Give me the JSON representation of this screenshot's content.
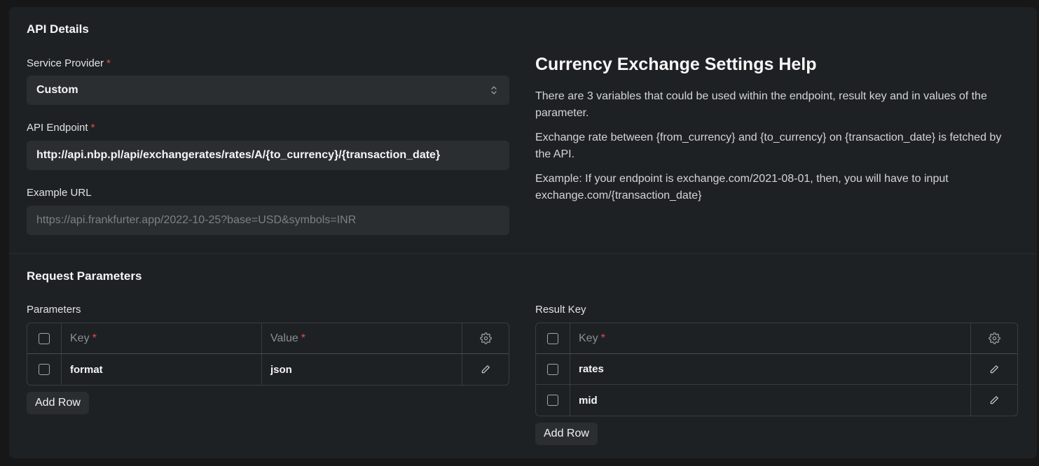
{
  "api_details": {
    "title": "API Details",
    "service_provider": {
      "label": "Service Provider",
      "required_mark": "*",
      "value": "Custom"
    },
    "api_endpoint": {
      "label": "API Endpoint",
      "required_mark": "*",
      "value": "http://api.nbp.pl/api/exchangerates/rates/A/{to_currency}/{transaction_date}"
    },
    "example_url": {
      "label": "Example URL",
      "placeholder": "https://api.frankfurter.app/2022-10-25?base=USD&symbols=INR"
    }
  },
  "help": {
    "title": "Currency Exchange Settings Help",
    "paragraphs": [
      "There are 3 variables that could be used within the endpoint, result key and in values of the parameter.",
      "Exchange rate between {from_currency} and {to_currency} on {transaction_date} is fetched by the API.",
      "Example: If your endpoint is exchange.com/2021-08-01, then, you will have to input exchange.com/{transaction_date}"
    ]
  },
  "request_parameters": {
    "title": "Request Parameters",
    "parameters": {
      "label": "Parameters",
      "columns": {
        "key": "Key",
        "value": "Value",
        "required_mark": "*"
      },
      "rows": [
        {
          "key": "format",
          "value": "json"
        }
      ],
      "add_row_label": "Add Row"
    },
    "result_key": {
      "label": "Result Key",
      "columns": {
        "key": "Key",
        "required_mark": "*"
      },
      "rows": [
        {
          "key": "rates"
        },
        {
          "key": "mid"
        }
      ],
      "add_row_label": "Add Row"
    }
  },
  "colors": {
    "background": "#171717",
    "card": "#1e2124",
    "input": "#2b2e31",
    "required": "#e24c4c"
  }
}
